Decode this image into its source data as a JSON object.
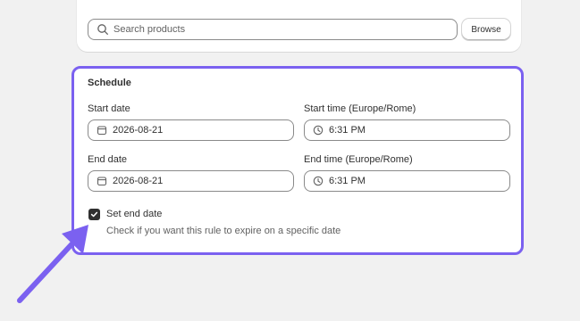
{
  "search": {
    "placeholder": "Search products",
    "browse_label": "Browse"
  },
  "schedule": {
    "heading": "Schedule",
    "start_date": {
      "label": "Start date",
      "value": "2026-08-21"
    },
    "start_time": {
      "label": "Start time (Europe/Rome)",
      "value": "6:31 PM"
    },
    "end_date": {
      "label": "End date",
      "value": "2026-08-21"
    },
    "end_time": {
      "label": "End time (Europe/Rome)",
      "value": "6:31 PM"
    },
    "set_end_date": {
      "label": "Set end date",
      "checked": true,
      "help": "Check if you want this rule to expire on a specific date"
    }
  },
  "colors": {
    "highlight": "#7b61f0",
    "background": "#f1f1f1"
  },
  "icons": [
    "search-icon",
    "calendar-icon",
    "clock-icon",
    "checkmark-icon",
    "annotation-arrow-icon"
  ]
}
